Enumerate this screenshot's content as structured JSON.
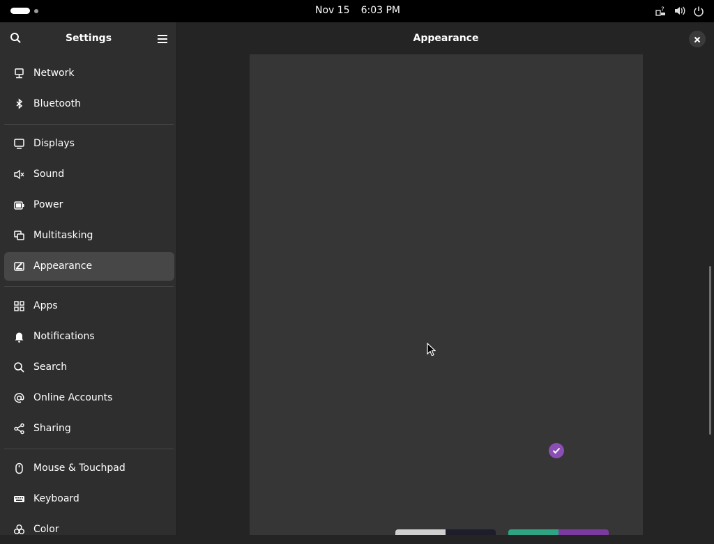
{
  "topbar": {
    "date": "Nov 15",
    "time": "6:03 PM",
    "tray_icons": [
      "network-unknown-icon",
      "volume-icon",
      "power-icon"
    ]
  },
  "sidebar": {
    "title": "Settings",
    "items": [
      {
        "label": "Network",
        "icon": "network-icon"
      },
      {
        "label": "Bluetooth",
        "icon": "bluetooth-icon"
      },
      {
        "label": "Displays",
        "icon": "display-icon"
      },
      {
        "label": "Sound",
        "icon": "speaker-icon"
      },
      {
        "label": "Power",
        "icon": "battery-icon"
      },
      {
        "label": "Multitasking",
        "icon": "multitasking-icon"
      },
      {
        "label": "Appearance",
        "icon": "appearance-icon",
        "active": true
      },
      {
        "label": "Apps",
        "icon": "apps-grid-icon"
      },
      {
        "label": "Notifications",
        "icon": "bell-icon"
      },
      {
        "label": "Search",
        "icon": "search-icon"
      },
      {
        "label": "Online Accounts",
        "icon": "at-sign-icon"
      },
      {
        "label": "Sharing",
        "icon": "share-icon"
      },
      {
        "label": "Mouse & Touchpad",
        "icon": "mouse-icon"
      },
      {
        "label": "Keyboard",
        "icon": "keyboard-icon"
      },
      {
        "label": "Color",
        "icon": "color-icon"
      }
    ]
  },
  "main": {
    "title": "Appearance"
  },
  "colors": {
    "accent": "#8a4fb5",
    "panel_bg": "#363636",
    "sidebar_bg": "#2e2e2e",
    "active_item_bg": "#474747"
  }
}
